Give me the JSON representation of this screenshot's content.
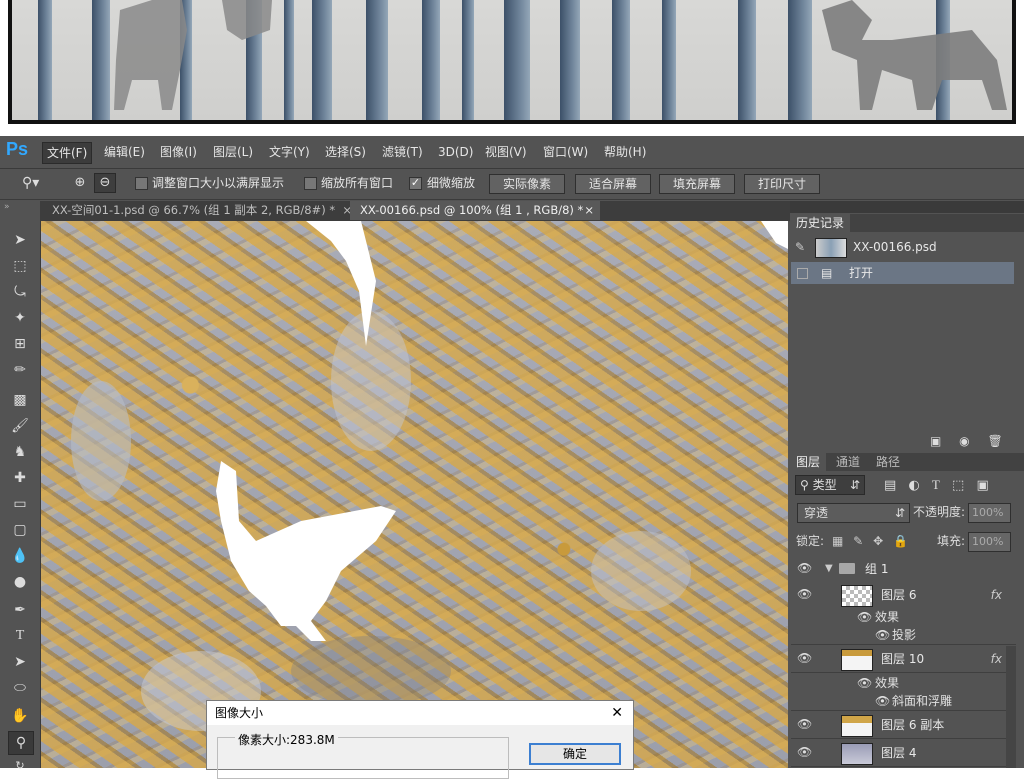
{
  "app": {
    "logo": "Ps"
  },
  "menu": [
    {
      "label": "文件(F)",
      "active": true
    },
    {
      "label": "编辑(E)"
    },
    {
      "label": "图像(I)"
    },
    {
      "label": "图层(L)"
    },
    {
      "label": "文字(Y)"
    },
    {
      "label": "选择(S)"
    },
    {
      "label": "滤镜(T)"
    },
    {
      "label": "3D(D)"
    },
    {
      "label": "视图(V)"
    },
    {
      "label": "窗口(W)"
    },
    {
      "label": "帮助(H)"
    }
  ],
  "options": {
    "resize_windows_label": "调整窗口大小以满屏显示",
    "resize_windows_checked": false,
    "zoom_all_label": "缩放所有窗口",
    "zoom_all_checked": false,
    "scrubby_zoom_label": "细微缩放",
    "scrubby_zoom_checked": true,
    "actual_pixels": "实际像素",
    "fit_screen": "适合屏幕",
    "fill_screen": "填充屏幕",
    "print_size": "打印尺寸"
  },
  "tabs": [
    {
      "label": "XX-空间01-1.psd @ 66.7% (组 1 副本 2, RGB/8#) *",
      "close": "×"
    },
    {
      "label": "XX-00166.psd @ 100% (组 1 , RGB/8) *",
      "close": "×"
    }
  ],
  "history": {
    "tab": "历史记录",
    "snapshot": "XX-00166.psd",
    "items": [
      "打开"
    ]
  },
  "layers_panel": {
    "tabs": [
      "图层",
      "通道",
      "路径"
    ],
    "kind": "类型",
    "blend_mode": "穿透",
    "opacity_label": "不透明度:",
    "opacity_value": "100%",
    "lock_label": "锁定:",
    "fill_label": "填充:",
    "fill_value": "100%",
    "group": "组 1",
    "layers": [
      {
        "name": "图层 6",
        "fx": "fx",
        "effects_label": "效果",
        "effects": [
          "投影"
        ]
      },
      {
        "name": "图层 10",
        "fx": "fx",
        "effects_label": "效果",
        "effects": [
          "斜面和浮雕"
        ]
      },
      {
        "name": "图层 6 副本"
      },
      {
        "name": "图层 4"
      }
    ]
  },
  "dialog": {
    "title": "图像大小",
    "close": "✕",
    "pixel_size_label": "像素大小:283.8M",
    "ok_button": "确定"
  }
}
